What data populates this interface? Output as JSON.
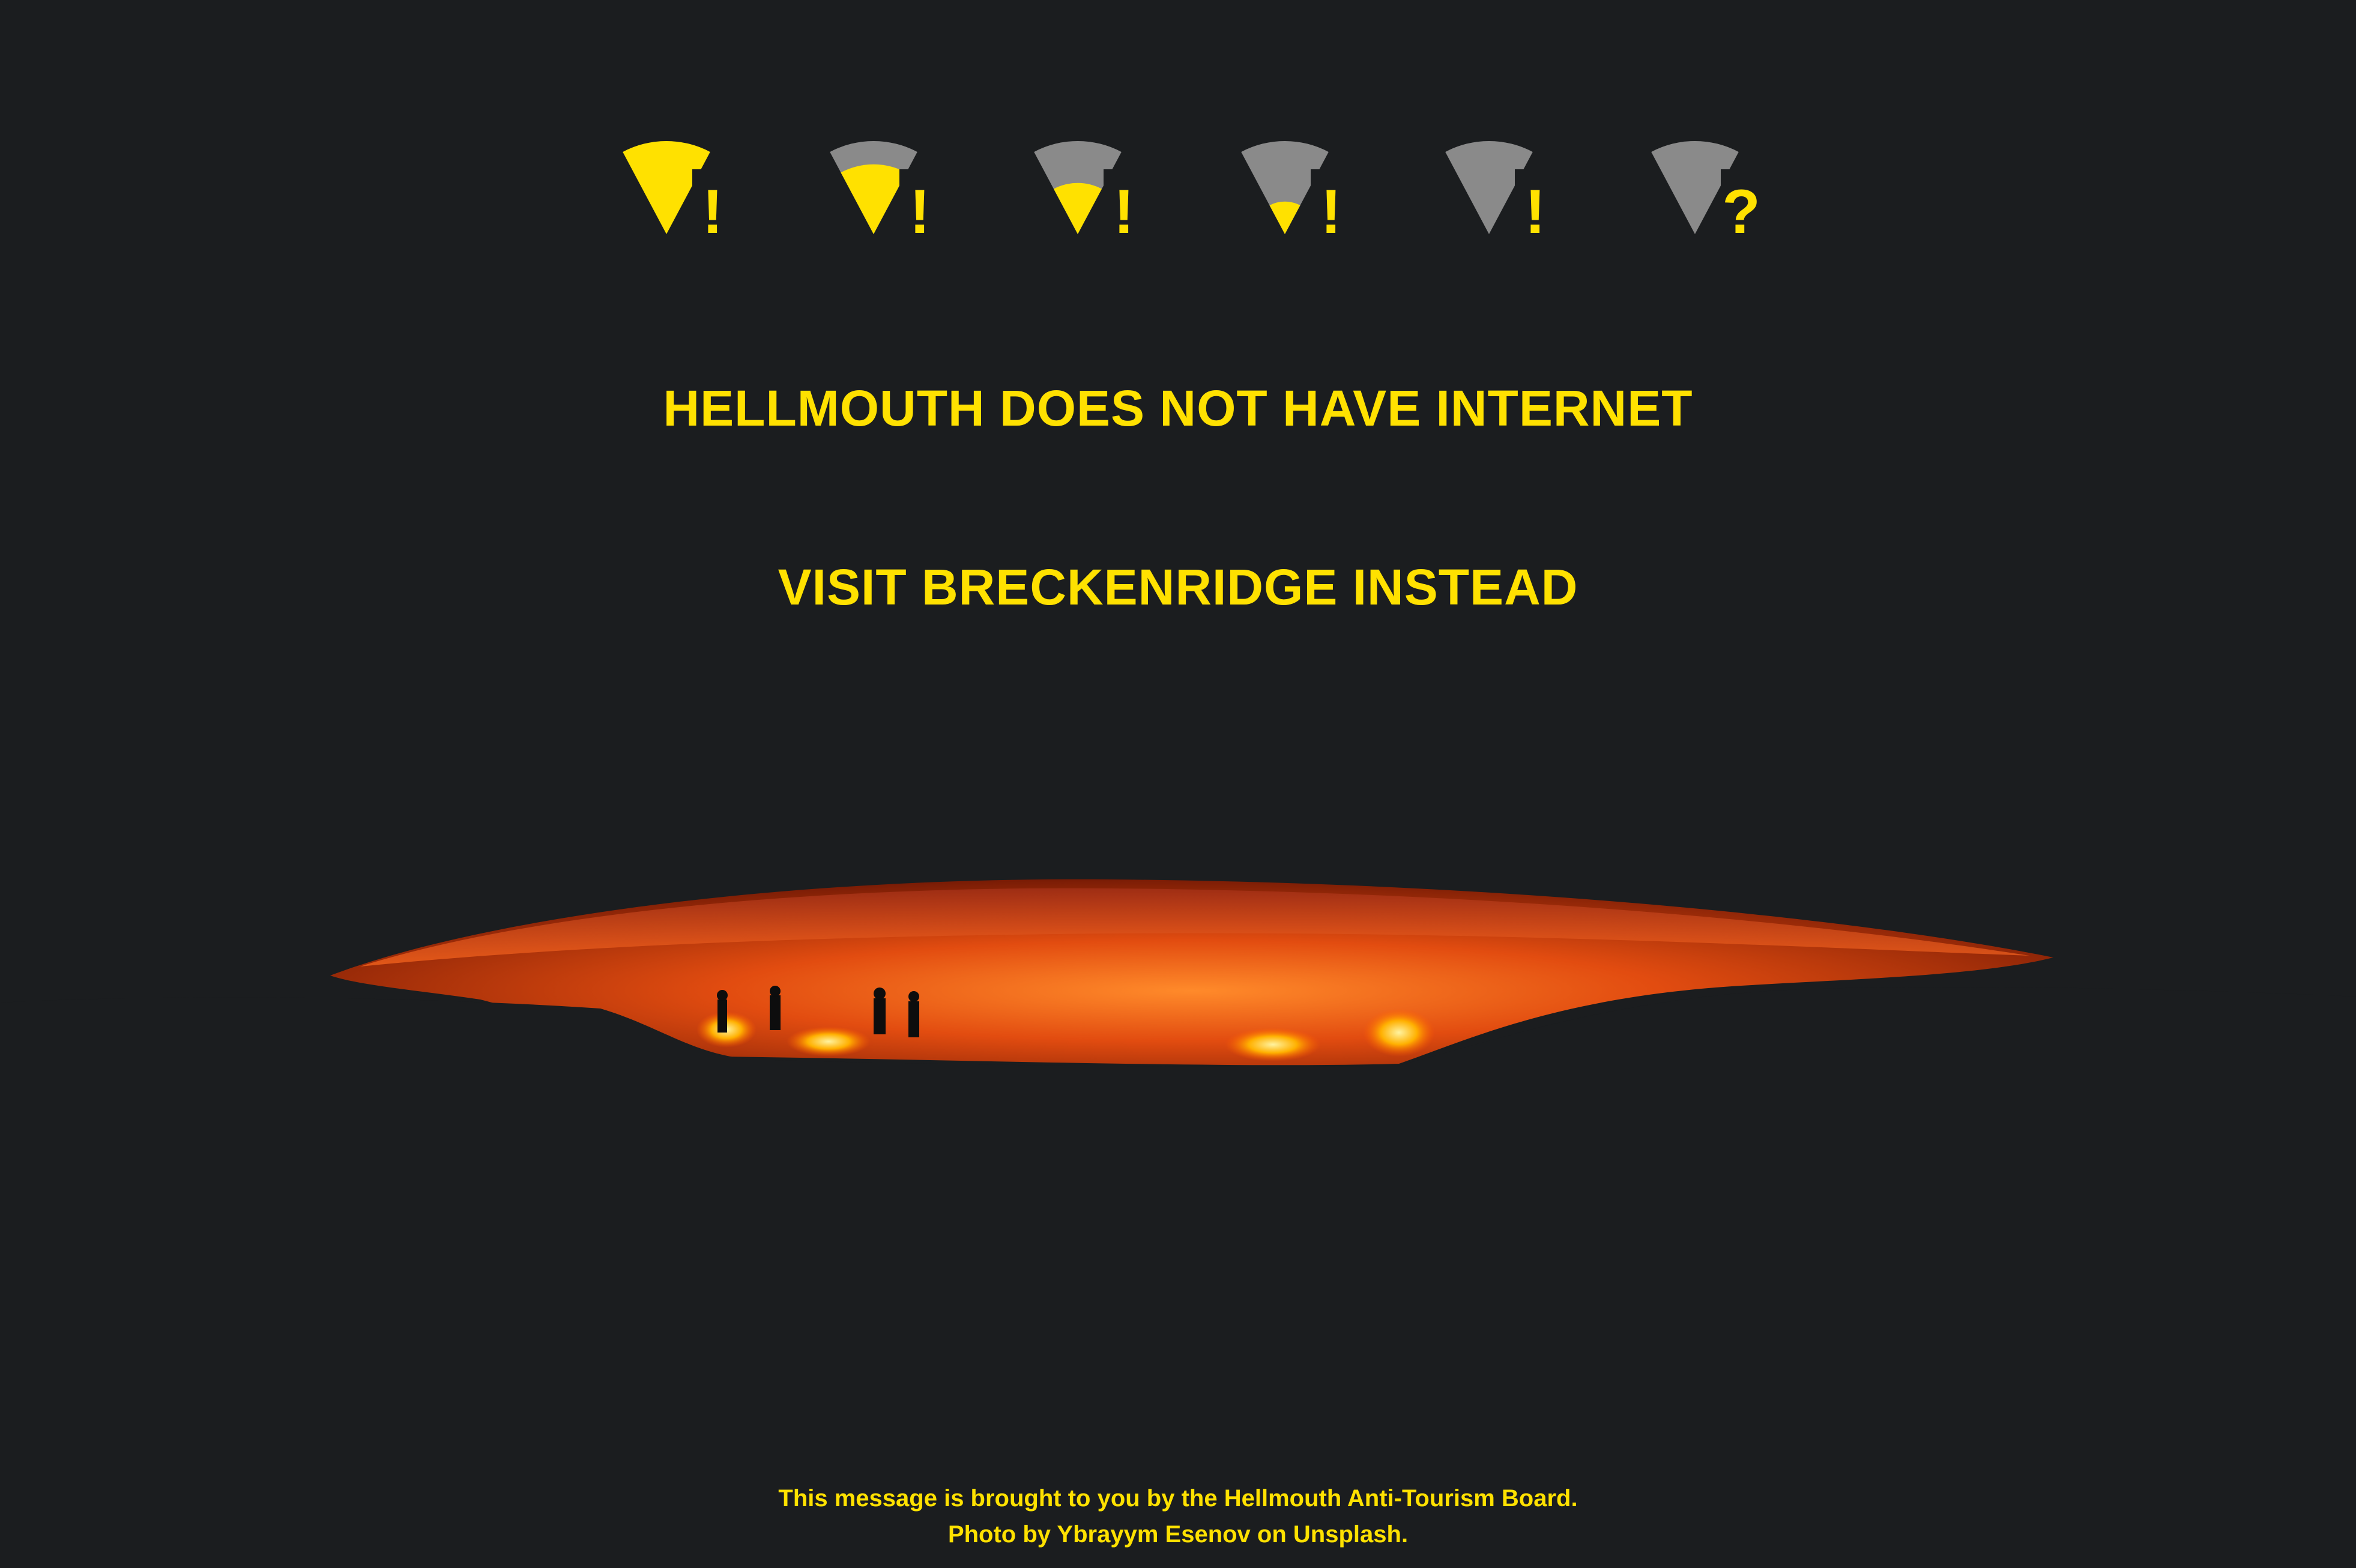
{
  "signal_indicators": [
    {
      "icon": "wifi-full-alert-icon",
      "badge": "!",
      "level": 1.0
    },
    {
      "icon": "wifi-high-alert-icon",
      "badge": "!",
      "level": 0.75
    },
    {
      "icon": "wifi-medium-alert-icon",
      "badge": "!",
      "level": 0.55
    },
    {
      "icon": "wifi-low-alert-icon",
      "badge": "!",
      "level": 0.35
    },
    {
      "icon": "wifi-empty-alert-icon",
      "badge": "!",
      "level": 0.0
    },
    {
      "icon": "wifi-unknown-icon",
      "badge": "?",
      "level": 0.0
    }
  ],
  "headline": "HELLMOUTH DOES NOT HAVE INTERNET",
  "subheadline": "VISIT BRECKENRIDGE INSTEAD",
  "footer": {
    "line1": "This message is brought to you by the Hellmouth Anti-Tourism Board.",
    "line2": "Photo by Ybrayym Esenov on Unsplash."
  },
  "colors": {
    "accent": "#ffe100",
    "signal_empty": "#8a8a8a",
    "background": "#1b1d1f"
  }
}
